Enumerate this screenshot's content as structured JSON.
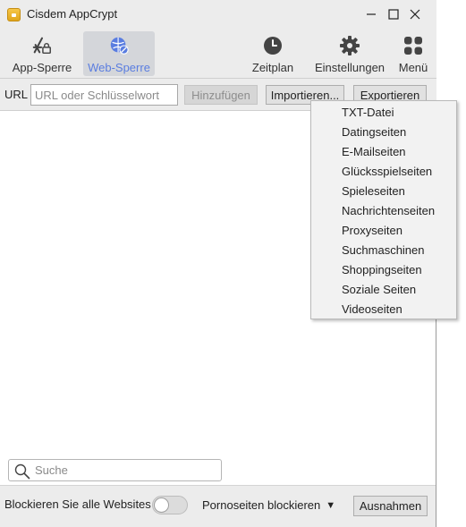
{
  "window": {
    "title": "Cisdem AppCrypt",
    "controls": {
      "minimize": "—",
      "maximize": "☐",
      "close": "✕"
    }
  },
  "toolbar": {
    "items": [
      {
        "label": "App-Sperre",
        "icon": "app-lock-icon",
        "selected": false
      },
      {
        "label": "Web-Sperre",
        "icon": "web-lock-icon",
        "selected": true
      },
      {
        "label": "Zeitplan",
        "icon": "clock-icon",
        "selected": false
      },
      {
        "label": "Einstellungen",
        "icon": "gear-icon",
        "selected": false
      },
      {
        "label": "Menü",
        "icon": "grid-icon",
        "selected": false
      }
    ],
    "accent": "#5a7de0"
  },
  "url_bar": {
    "label": "URL",
    "placeholder": "URL oder Schlüsselwort",
    "value": "",
    "add_label": "Hinzufügen",
    "import_label": "Importieren...",
    "export_label": "Exportieren"
  },
  "import_menu": {
    "items": [
      "TXT-Datei",
      "Datingseiten",
      "E-Mailseiten",
      "Glücksspielseiten",
      "Spieleseiten",
      "Nachrichtenseiten",
      "Proxyseiten",
      "Suchmaschinen",
      "Shoppingseiten",
      "Soziale Seiten",
      "Videoseiten"
    ]
  },
  "search": {
    "placeholder": "Suche",
    "value": ""
  },
  "bottom": {
    "block_all_label": "Blockieren Sie alle Websites",
    "block_all_on": false,
    "porn_label": "Pornoseiten blockieren",
    "porn_caret": "▼",
    "exceptions_label": "Ausnahmen"
  }
}
